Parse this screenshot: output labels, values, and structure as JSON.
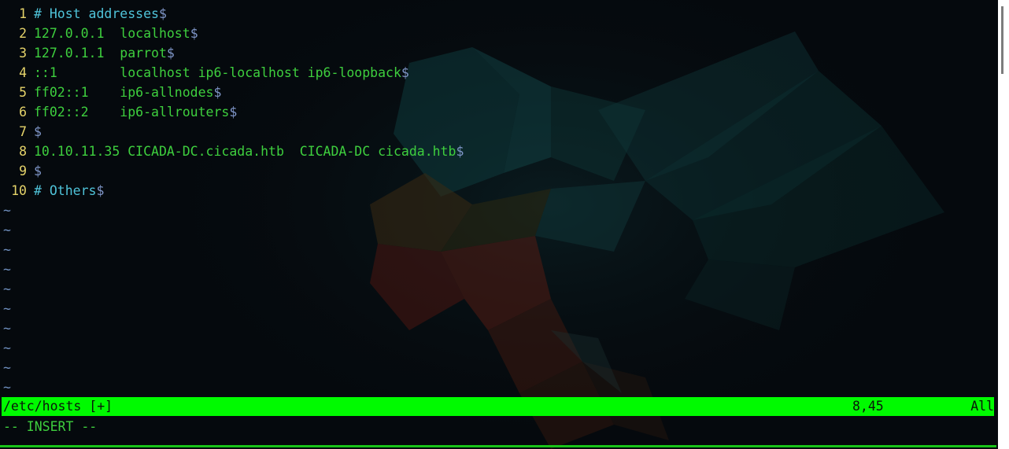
{
  "editor": {
    "lines": [
      {
        "num": "1",
        "segments": [
          {
            "text": "# Host addresses",
            "kind": "comment"
          },
          {
            "text": "$",
            "kind": "eol"
          }
        ]
      },
      {
        "num": "2",
        "segments": [
          {
            "text": "127.0.0.1  localhost",
            "kind": "txt"
          },
          {
            "text": "$",
            "kind": "eol"
          }
        ]
      },
      {
        "num": "3",
        "segments": [
          {
            "text": "127.0.1.1  parrot",
            "kind": "txt"
          },
          {
            "text": "$",
            "kind": "eol"
          }
        ]
      },
      {
        "num": "4",
        "segments": [
          {
            "text": "::1        localhost ip6-localhost ip6-loopback",
            "kind": "txt"
          },
          {
            "text": "$",
            "kind": "eol"
          }
        ]
      },
      {
        "num": "5",
        "segments": [
          {
            "text": "ff02::1    ip6-allnodes",
            "kind": "txt"
          },
          {
            "text": "$",
            "kind": "eol"
          }
        ]
      },
      {
        "num": "6",
        "segments": [
          {
            "text": "ff02::2    ip6-allrouters",
            "kind": "txt"
          },
          {
            "text": "$",
            "kind": "eol"
          }
        ]
      },
      {
        "num": "7",
        "segments": [
          {
            "text": "$",
            "kind": "eol"
          }
        ]
      },
      {
        "num": "8",
        "segments": [
          {
            "text": "10.10.11.35 CICADA-DC.cicada.htb  CICADA-DC cicada.htb",
            "kind": "txt"
          },
          {
            "text": "$",
            "kind": "eol"
          }
        ]
      },
      {
        "num": "9",
        "segments": [
          {
            "text": "$",
            "kind": "eol"
          }
        ]
      },
      {
        "num": "10",
        "segments": [
          {
            "text": "# Others",
            "kind": "comment"
          },
          {
            "text": "$",
            "kind": "eol"
          }
        ]
      }
    ],
    "tilde": "~",
    "tilde_lines": 10
  },
  "statusline": {
    "file": "/etc/hosts [+]",
    "position": "8,45",
    "scroll": "All"
  },
  "mode": "-- INSERT --",
  "colors": {
    "status_bg": "#00fa00",
    "text_green": "#3ecf3e",
    "comment_cyan": "#4fc3d9",
    "line_number_yellow": "#e5d36a",
    "eol_marker_blue": "#7f96c8",
    "background": "#05090d"
  },
  "background": {
    "icon": "parrot-logo-icon"
  }
}
